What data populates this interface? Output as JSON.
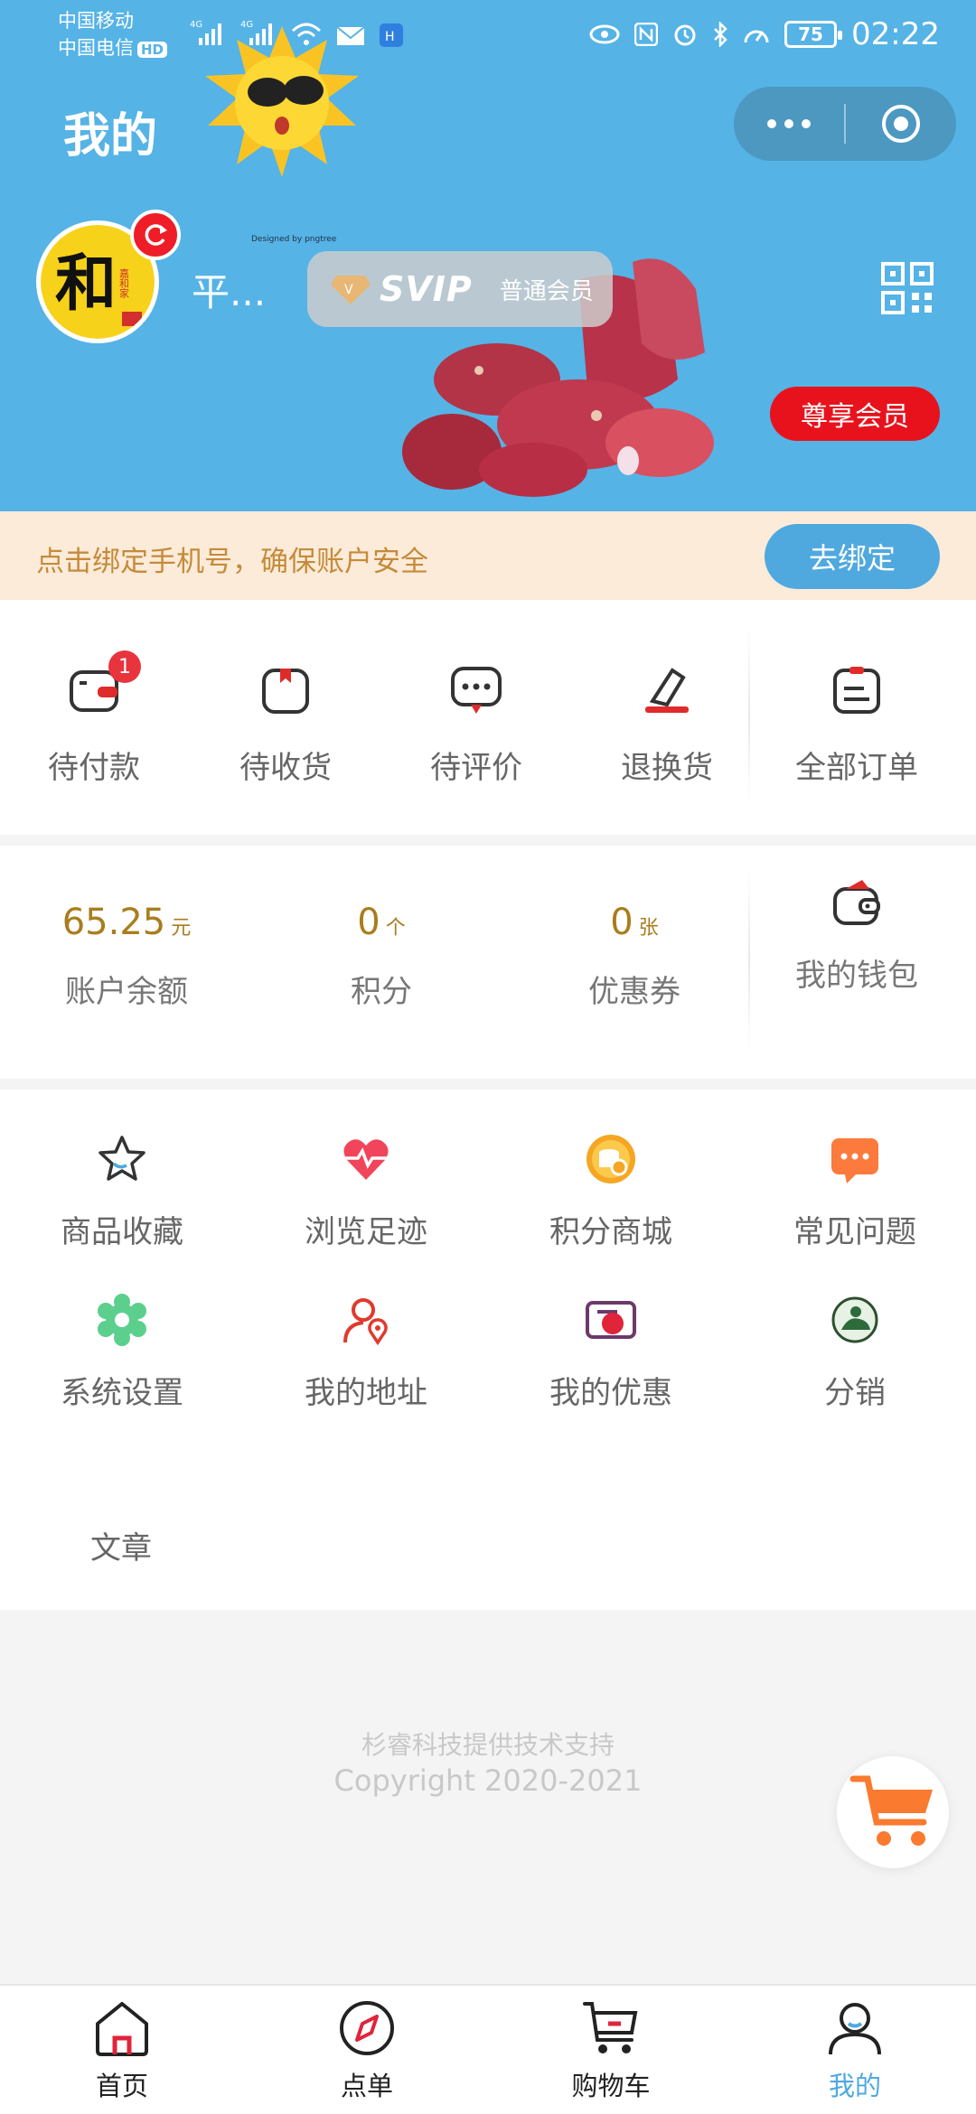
{
  "status_bar": {
    "carrier1": "中国移动",
    "carrier2": "中国电信",
    "hd": "HD",
    "signal1": "4G",
    "signal2": "4G",
    "battery": "75",
    "time": "02:22"
  },
  "header": {
    "title": "我的",
    "username": "平...",
    "svip_label": "SVIP",
    "member_level": "普通会员",
    "vip_button": "尊享会员",
    "sun_caption": "Designed by pngtree",
    "avatar_text": "和",
    "avatar_side_text": "嘉和家"
  },
  "bind": {
    "text": "点击绑定手机号，确保账户安全",
    "button": "去绑定"
  },
  "orders": [
    {
      "label": "待付款",
      "icon": "wallet-card-icon",
      "badge": "1"
    },
    {
      "label": "待收货",
      "icon": "package-icon"
    },
    {
      "label": "待评价",
      "icon": "comment-icon"
    },
    {
      "label": "退换货",
      "icon": "eraser-icon"
    },
    {
      "label": "全部订单",
      "icon": "order-list-icon"
    }
  ],
  "wallet": {
    "balance": {
      "value": "65.25",
      "unit": "元",
      "label": "账户余额"
    },
    "points": {
      "value": "0",
      "unit": "个",
      "label": "积分"
    },
    "coupons": {
      "value": "0",
      "unit": "张",
      "label": "优惠券"
    },
    "my_wallet": "我的钱包"
  },
  "services": [
    {
      "label": "商品收藏",
      "icon": "star-icon"
    },
    {
      "label": "浏览足迹",
      "icon": "heartbeat-icon"
    },
    {
      "label": "积分商城",
      "icon": "coin-icon"
    },
    {
      "label": "常见问题",
      "icon": "chat-bubble-icon"
    },
    {
      "label": "系统设置",
      "icon": "gear-icon"
    },
    {
      "label": "我的地址",
      "icon": "address-icon"
    },
    {
      "label": "我的优惠",
      "icon": "coupon-icon"
    },
    {
      "label": "分销",
      "icon": "distribution-icon"
    }
  ],
  "article": "文章",
  "footer": {
    "support": "杉睿科技提供技术支持",
    "copyright": "Copyright 2020-2021"
  },
  "tabs": [
    {
      "label": "首页",
      "icon": "home-icon"
    },
    {
      "label": "点单",
      "icon": "compass-icon"
    },
    {
      "label": "购物车",
      "icon": "cart-icon"
    },
    {
      "label": "我的",
      "icon": "user-icon",
      "active": true
    }
  ],
  "colors": {
    "header_bg": "#55b3e6",
    "accent": "#4fa9df",
    "vip_red": "#e8121d",
    "gold": "#a97d1d"
  }
}
